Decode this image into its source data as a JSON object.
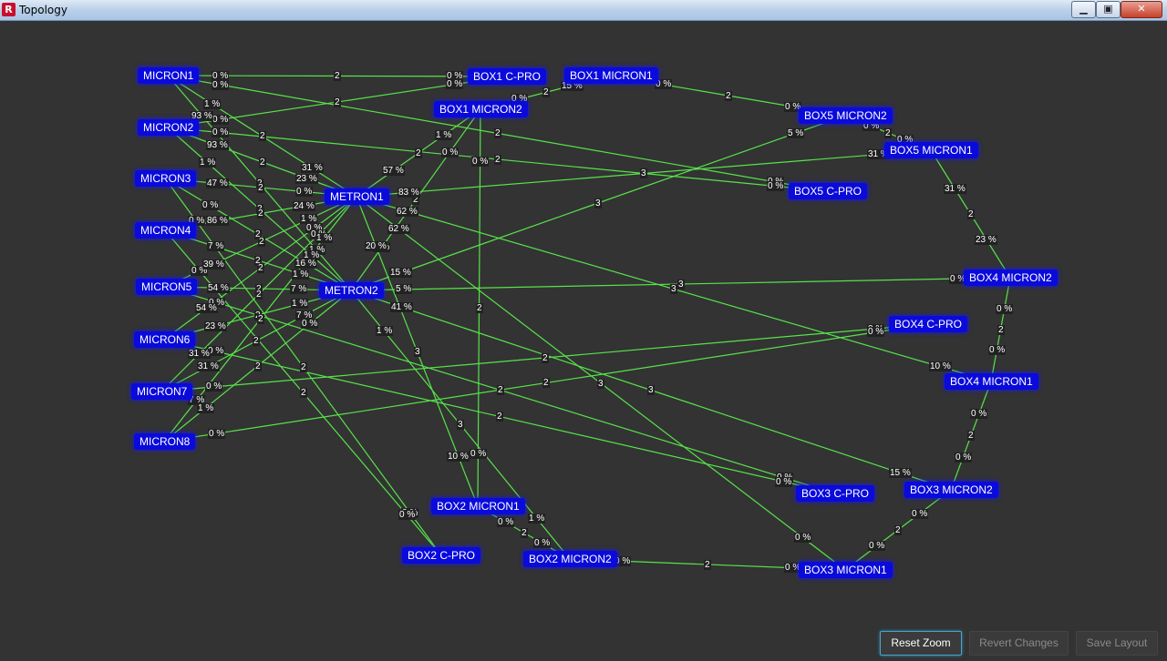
{
  "window": {
    "title": "Topology",
    "icon": "R",
    "minimize": "▁",
    "maximize": "▣",
    "close": "✕"
  },
  "colors": {
    "background": "#333333",
    "link": "#57e34a",
    "node": "#0a0adb",
    "label_bg": "#222222"
  },
  "nodes": {
    "MICRON1": "MICRON1",
    "MICRON2": "MICRON2",
    "MICRON3": "MICRON3",
    "MICRON4": "MICRON4",
    "MICRON5": "MICRON5",
    "MICRON6": "MICRON6",
    "MICRON7": "MICRON7",
    "MICRON8": "MICRON8",
    "METRON1": "METRON1",
    "METRON2": "METRON2",
    "BOX1CPRO": "BOX1 C-PRO",
    "BOX1MICRON1": "BOX1 MICRON1",
    "BOX1MICRON2": "BOX1 MICRON2",
    "BOX5MICRON2": "BOX5 MICRON2",
    "BOX5MICRON1": "BOX5 MICRON1",
    "BOX5CPRO": "BOX5 C-PRO",
    "BOX4MICRON2": "BOX4 MICRON2",
    "BOX4CPRO": "BOX4 C-PRO",
    "BOX4MICRON1": "BOX4 MICRON1",
    "BOX3MICRON2": "BOX3 MICRON2",
    "BOX3CPRO": "BOX3 C-PRO",
    "BOX3MICRON1": "BOX3 MICRON1",
    "BOX2MICRON1": "BOX2 MICRON1",
    "BOX2MICRON2": "BOX2 MICRON2",
    "BOX2CPRO": "BOX2 C-PRO"
  },
  "links": [
    {
      "a": "MICRON1",
      "b": "BOX1CPRO",
      "a_util": "0 %",
      "b_util": "0 %",
      "cost": "2"
    },
    {
      "a": "MICRON2",
      "b": "BOX1CPRO",
      "a_util": "0 %",
      "b_util": "0 %",
      "cost": "2"
    },
    {
      "a": "MICRON1",
      "b": "METRON1",
      "a_util": "1 %",
      "b_util": "31 %",
      "cost": "2"
    },
    {
      "a": "MICRON1",
      "b": "METRON2",
      "a_util": "93 %",
      "b_util": "1 %",
      "cost": "2"
    },
    {
      "a": "MICRON1",
      "b": "BOX5CPRO",
      "a_util": "0 %",
      "b_util": "0 %",
      "cost": "2"
    },
    {
      "a": "MICRON2",
      "b": "METRON1",
      "a_util": "93 %",
      "b_util": "23 %",
      "cost": "2"
    },
    {
      "a": "MICRON2",
      "b": "METRON2",
      "a_util": "1 %",
      "b_util": "1 %",
      "cost": "2"
    },
    {
      "a": "MICRON2",
      "b": "BOX5CPRO",
      "a_util": "0 %",
      "b_util": "0 %",
      "cost": "2"
    },
    {
      "a": "MICRON3",
      "b": "METRON1",
      "a_util": "47 %",
      "b_util": "0 %",
      "cost": "2"
    },
    {
      "a": "MICRON3",
      "b": "METRON2",
      "a_util": "0 %",
      "b_util": "16 %",
      "cost": "2"
    },
    {
      "a": "MICRON3",
      "b": "BOX2CPRO",
      "a_util": "0 %",
      "b_util": "0 %",
      "cost": "2"
    },
    {
      "a": "MICRON4",
      "b": "METRON1",
      "a_util": "86 %",
      "b_util": "24 %",
      "cost": "2"
    },
    {
      "a": "MICRON4",
      "b": "METRON2",
      "a_util": "7 %",
      "b_util": "1 %",
      "cost": "2"
    },
    {
      "a": "MICRON4",
      "b": "BOX2CPRO",
      "a_util": "0 %",
      "b_util": "0 %",
      "cost": "2"
    },
    {
      "a": "MICRON5",
      "b": "METRON1",
      "a_util": "39 %",
      "b_util": "1 %",
      "cost": "2"
    },
    {
      "a": "MICRON5",
      "b": "METRON2",
      "a_util": "54 %",
      "b_util": "7 %",
      "cost": "2"
    },
    {
      "a": "MICRON5",
      "b": "BOX3CPRO",
      "a_util": "0 %",
      "b_util": "0 %",
      "cost": "2"
    },
    {
      "a": "MICRON6",
      "b": "METRON1",
      "a_util": "54 %",
      "b_util": "0 %",
      "cost": "2"
    },
    {
      "a": "MICRON6",
      "b": "METRON2",
      "a_util": "23 %",
      "b_util": "1 %",
      "cost": "2"
    },
    {
      "a": "MICRON6",
      "b": "BOX3CPRO",
      "a_util": "0 %",
      "b_util": "0 %",
      "cost": "2"
    },
    {
      "a": "MICRON7",
      "b": "METRON1",
      "a_util": "31 %",
      "b_util": "0 %",
      "cost": "2"
    },
    {
      "a": "MICRON7",
      "b": "METRON2",
      "a_util": "31 %",
      "b_util": "7 %",
      "cost": "2"
    },
    {
      "a": "MICRON7",
      "b": "BOX4CPRO",
      "a_util": "0 %",
      "b_util": "0 %",
      "cost": "2"
    },
    {
      "a": "MICRON8",
      "b": "METRON1",
      "a_util": "7 %",
      "b_util": "1 %",
      "cost": "2"
    },
    {
      "a": "MICRON8",
      "b": "METRON2",
      "a_util": "1 %",
      "b_util": "0 %",
      "cost": "2"
    },
    {
      "a": "MICRON8",
      "b": "BOX4CPRO",
      "a_util": "0 %",
      "b_util": "0 %",
      "cost": "2"
    },
    {
      "a": "METRON1",
      "b": "BOX1MICRON2",
      "a_util": "57 %",
      "b_util": "1 %",
      "cost": "2"
    },
    {
      "a": "METRON2",
      "b": "BOX1MICRON2",
      "a_util": "1 %",
      "b_util": "0 %",
      "cost": "2"
    },
    {
      "a": "METRON1",
      "b": "BOX5MICRON1",
      "a_util": "83 %",
      "b_util": "31 %",
      "cost": "3"
    },
    {
      "a": "METRON2",
      "b": "BOX5MICRON2",
      "a_util": "15 %",
      "b_util": "5 %",
      "cost": "3"
    },
    {
      "a": "METRON1",
      "b": "BOX4MICRON1",
      "a_util": "62 %",
      "b_util": "10 %",
      "cost": "3"
    },
    {
      "a": "METRON2",
      "b": "BOX4MICRON2",
      "a_util": "5 %",
      "b_util": "0 %",
      "cost": "3"
    },
    {
      "a": "METRON1",
      "b": "BOX3MICRON1",
      "a_util": "62 %",
      "b_util": "0 %",
      "cost": "3"
    },
    {
      "a": "METRON2",
      "b": "BOX3MICRON2",
      "a_util": "41 %",
      "b_util": "15 %",
      "cost": "3"
    },
    {
      "a": "METRON1",
      "b": "BOX2MICRON1",
      "a_util": "20 %",
      "b_util": "10 %",
      "cost": "3"
    },
    {
      "a": "METRON2",
      "b": "BOX2MICRON2",
      "a_util": "1 %",
      "b_util": "1 %",
      "cost": "3"
    },
    {
      "a": "BOX1MICRON2",
      "b": "BOX1MICRON1",
      "a_util": "0 %",
      "b_util": "15 %",
      "cost": "2"
    },
    {
      "a": "BOX1MICRON1",
      "b": "BOX5MICRON2",
      "a_util": "0 %",
      "b_util": "0 %",
      "cost": "2"
    },
    {
      "a": "BOX5MICRON2",
      "b": "BOX5MICRON1",
      "a_util": "0 %",
      "b_util": "0 %",
      "cost": "2"
    },
    {
      "a": "BOX5MICRON1",
      "b": "BOX4MICRON2",
      "a_util": "31 %",
      "b_util": "23 %",
      "cost": "2"
    },
    {
      "a": "BOX4MICRON2",
      "b": "BOX4MICRON1",
      "a_util": "0 %",
      "b_util": "0 %",
      "cost": "2"
    },
    {
      "a": "BOX4MICRON1",
      "b": "BOX3MICRON2",
      "a_util": "0 %",
      "b_util": "0 %",
      "cost": "2"
    },
    {
      "a": "BOX3MICRON2",
      "b": "BOX3MICRON1",
      "a_util": "0 %",
      "b_util": "0 %",
      "cost": "2"
    },
    {
      "a": "BOX3MICRON1",
      "b": "BOX2MICRON2",
      "a_util": "0 %",
      "b_util": "0 %",
      "cost": "2"
    },
    {
      "a": "BOX2MICRON2",
      "b": "BOX2MICRON1",
      "a_util": "0 %",
      "b_util": "0 %",
      "cost": "2"
    },
    {
      "a": "BOX2MICRON1",
      "b": "BOX1MICRON2",
      "a_util": "0 %",
      "b_util": "0 %",
      "cost": "2"
    }
  ],
  "buttons": {
    "reset_zoom": "Reset Zoom",
    "revert_changes": "Revert Changes",
    "save_layout": "Save Layout"
  }
}
